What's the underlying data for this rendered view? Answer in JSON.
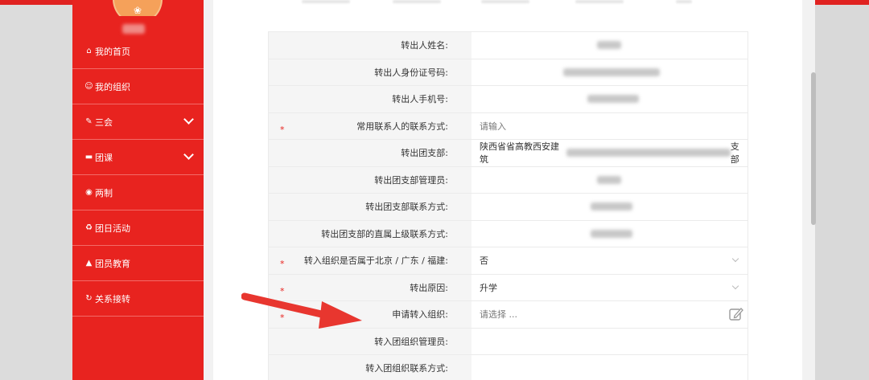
{
  "sidebar": {
    "items": [
      {
        "icon": "home-icon",
        "glyph": "⌂",
        "label": "我的首页",
        "expandable": false
      },
      {
        "icon": "users-icon",
        "glyph": "☺",
        "label": "我的组织",
        "expandable": false
      },
      {
        "icon": "edit-square-icon",
        "glyph": "✎",
        "label": "三会",
        "expandable": true
      },
      {
        "icon": "folder-icon",
        "glyph": "▬",
        "label": "团课",
        "expandable": true
      },
      {
        "icon": "target-icon",
        "glyph": "◉",
        "label": "两制",
        "expandable": false
      },
      {
        "icon": "recycle-icon",
        "glyph": "♻",
        "label": "团日活动",
        "expandable": false
      },
      {
        "icon": "graduation-cap-icon",
        "glyph": "▲",
        "label": "团员教育",
        "expandable": false
      },
      {
        "icon": "refresh-icon",
        "glyph": "↻",
        "label": "关系接转",
        "expandable": false
      }
    ]
  },
  "form": {
    "rows": [
      {
        "label": "转出人姓名:",
        "required": false
      },
      {
        "label": "转出人身份证号码:",
        "required": false
      },
      {
        "label": "转出人手机号:",
        "required": false
      },
      {
        "label": "常用联系人的联系方式:",
        "required": true,
        "placeholder": "请输入"
      },
      {
        "label": "转出团支部:",
        "required": false,
        "value": "陕西省省高教西安建筑",
        "suffix": "支部"
      },
      {
        "label": "转出团支部管理员:",
        "required": false
      },
      {
        "label": "转出团支部联系方式:",
        "required": false
      },
      {
        "label": "转出团支部的直属上级联系方式:",
        "required": false
      },
      {
        "label": "转入组织是否属于北京 / 广东 / 福建:",
        "required": true,
        "value": "否"
      },
      {
        "label": "转出原因:",
        "required": true,
        "value": "升学"
      },
      {
        "label": "申请转入组织:",
        "required": true,
        "placeholder": "请选择 ..."
      },
      {
        "label": "转入团组织管理员:",
        "required": false
      },
      {
        "label": "转入团组织联系方式:",
        "required": false
      }
    ],
    "required_mark": "*"
  },
  "colors": {
    "brand_red": "#e8231f",
    "label_bg": "#f5f5f5",
    "arrow_red": "#e8362f"
  }
}
